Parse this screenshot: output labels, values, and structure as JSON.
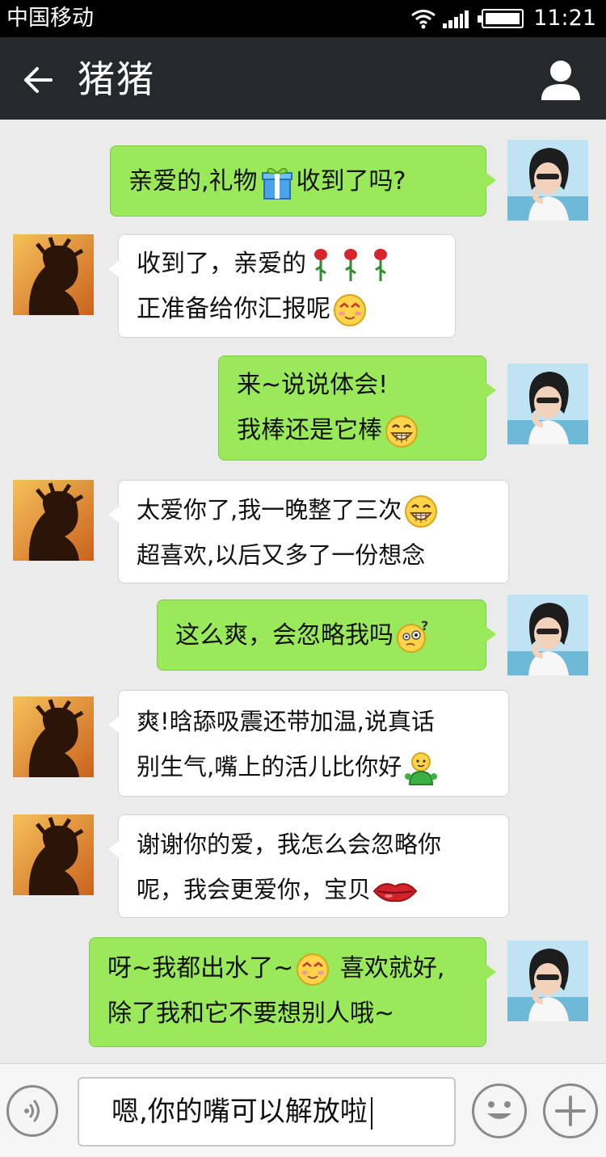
{
  "status_bar": {
    "carrier": "中国移动",
    "time": "11:21",
    "icons": [
      "wifi-icon",
      "signal-icon",
      "battery-icon"
    ]
  },
  "header": {
    "back_icon": "arrow-left-icon",
    "title": "猪猪",
    "profile_icon": "person-icon"
  },
  "messages": [
    {
      "side": "sent",
      "lines": [
        {
          "text": "亲爱的,礼物",
          "emoji": "gift",
          "after": "收到了吗?"
        }
      ]
    },
    {
      "side": "received",
      "lines": [
        {
          "text": "收到了，亲爱的",
          "emoji": "roses"
        },
        {
          "text": "正准备给你汇报呢",
          "emoji": "blush"
        }
      ]
    },
    {
      "side": "sent",
      "lines": [
        {
          "text": "来~说说体会!"
        },
        {
          "text": "我棒还是它棒",
          "emoji": "grin"
        }
      ]
    },
    {
      "side": "received",
      "lines": [
        {
          "text": "太爱你了,我一晚整了三次",
          "emoji": "grin"
        },
        {
          "text": "超喜欢,以后又多了一份想念"
        }
      ]
    },
    {
      "side": "sent",
      "lines": [
        {
          "text": "这么爽，会忽略我吗",
          "emoji": "question-face"
        }
      ]
    },
    {
      "side": "received",
      "lines": [
        {
          "text": "爽!晗舔吸震还带加温,说真话"
        },
        {
          "text": "别生气,嘴上的活儿比你好",
          "emoji": "green-figure"
        }
      ]
    },
    {
      "side": "received",
      "lines": [
        {
          "text": "谢谢你的爱，我怎么会忽略你"
        },
        {
          "text": "呢，我会更爱你，宝贝",
          "emoji": "lips"
        }
      ]
    },
    {
      "side": "sent",
      "lines": [
        {
          "text": "呀~我都出水了~",
          "emoji": "blush",
          "after": "喜欢就好,"
        },
        {
          "text": "除了我和它不要想别人哦~"
        }
      ]
    }
  ],
  "input": {
    "value": "嗯,你的嘴可以解放啦",
    "voice_icon": "voice-icon",
    "emoji_icon": "smiley-icon",
    "plus_icon": "plus-icon"
  },
  "colors": {
    "sent_bubble": "#9ae95a",
    "received_bubble": "#ffffff",
    "chat_background": "#ebebeb",
    "title_bar": "#25292c"
  }
}
